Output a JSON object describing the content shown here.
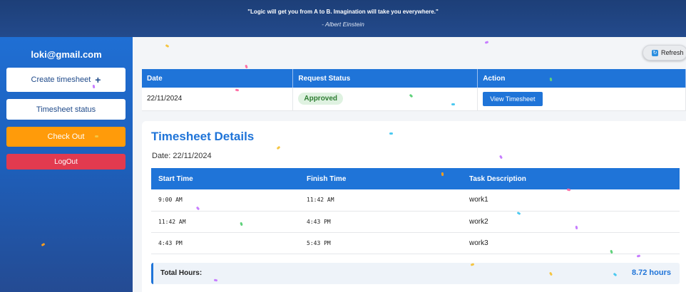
{
  "banner": {
    "quote": "\"Logic will get you from A to B. Imagination will take you everywhere.\"",
    "author": "- Albert Einstein"
  },
  "sidebar": {
    "email": "loki@gmail.com",
    "create_label": "Create timesheet",
    "create_icon": "plus-icon",
    "status_label": "Timesheet status",
    "checkout_label": "Check Out",
    "logout_label": "LogOut"
  },
  "toolbar": {
    "refresh_label": "Refresh",
    "refresh_icon": "refresh-icon"
  },
  "requests": {
    "columns": [
      "Date",
      "Request Status",
      "Action"
    ],
    "rows": [
      {
        "date": "22/11/2024",
        "status": "Approved",
        "action": "View Timesheet"
      }
    ]
  },
  "details": {
    "title": "Timesheet Details",
    "date": "Date: 22/11/2024",
    "columns": [
      "Start Time",
      "Finish Time",
      "Task Description"
    ],
    "rows": [
      {
        "start": "9:00 AM",
        "finish": "11:42 AM",
        "task": "work1"
      },
      {
        "start": "11:42 AM",
        "finish": "4:43 PM",
        "task": "work2"
      },
      {
        "start": "4:43 PM",
        "finish": "5:43 PM",
        "task": "work3"
      }
    ],
    "total_label": "Total Hours:",
    "total_value": "8.72 hours"
  },
  "colors": {
    "primary": "#1f74d8",
    "banner": "#1d3f78",
    "checkout": "#ff9b0a",
    "logout": "#e23a4f",
    "approved_bg": "#dff2e1",
    "approved_text": "#2e7d32"
  }
}
